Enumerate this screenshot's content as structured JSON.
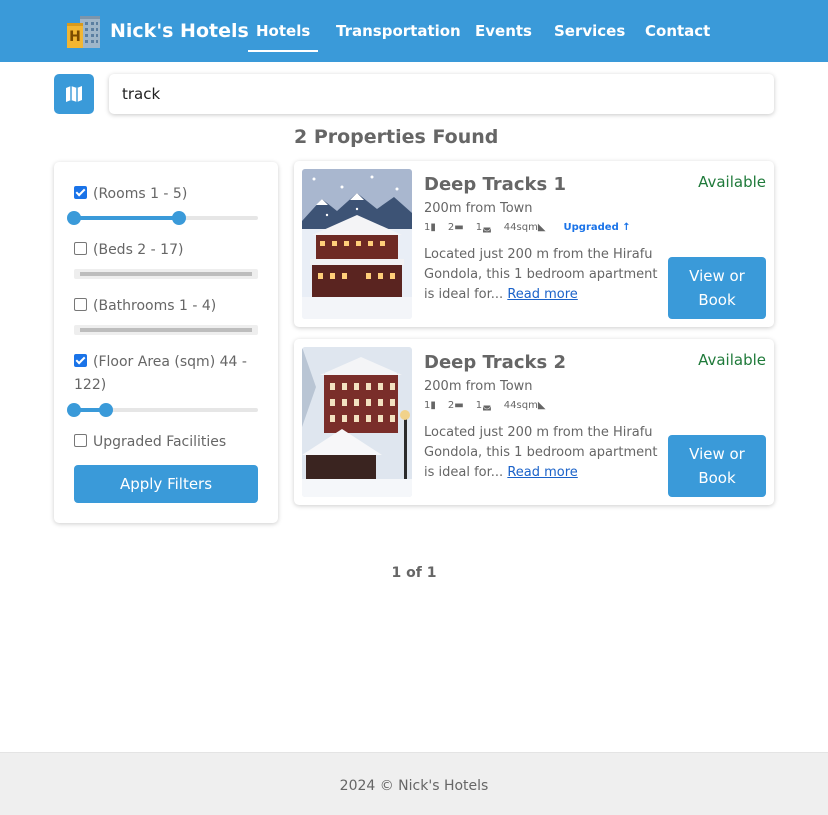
{
  "brand": {
    "name": "Nick's Hotels",
    "icon": "hotel-building-icon"
  },
  "nav": {
    "items": [
      {
        "label": "Hotels",
        "active": true
      },
      {
        "label": "Transportation",
        "active": false
      },
      {
        "label": "Events",
        "active": false
      },
      {
        "label": "Services",
        "active": false
      },
      {
        "label": "Contact",
        "active": false
      }
    ]
  },
  "search": {
    "value": "track",
    "map_icon": "map-icon"
  },
  "results": {
    "title": "2 Properties Found"
  },
  "filters": {
    "rooms": {
      "label": "(Rooms 1 - 5)",
      "checked": true,
      "range": [
        1,
        5
      ]
    },
    "beds": {
      "label": "(Beds 2 - 17)",
      "checked": false,
      "range": [
        2,
        17
      ]
    },
    "bathrooms": {
      "label": "(Bathrooms 1 - 4)",
      "checked": false,
      "range": [
        1,
        4
      ]
    },
    "floor_area": {
      "label": "(Floor Area (sqm) 44 - 122)",
      "checked": true,
      "range": [
        44,
        122
      ]
    },
    "upgraded": {
      "label": "Upgraded Facilities",
      "checked": false
    },
    "apply_label": "Apply Filters"
  },
  "properties": [
    {
      "title": "Deep Tracks 1",
      "distance": "200m from Town",
      "rooms": "1",
      "beds": "2",
      "baths": "1",
      "area": "44sqm",
      "upgraded": "Upgraded ↑",
      "status": "Available",
      "description": "Located just 200 m from the Hirafu Gondola, this 1 bedroom apartment is ideal for...",
      "read_more": "Read more",
      "button": "View or Book"
    },
    {
      "title": "Deep Tracks 2",
      "distance": "200m from Town",
      "rooms": "1",
      "beds": "2",
      "baths": "1",
      "area": "44sqm",
      "upgraded": "",
      "status": "Available",
      "description": "Located just 200 m from the Hirafu Gondola, this 1 bedroom apartment is ideal for...",
      "read_more": "Read more",
      "button": "View or Book"
    }
  ],
  "pagination": {
    "text": "1 of 1"
  },
  "footer": {
    "text": "2024 © Nick's Hotels"
  },
  "colors": {
    "primary": "#3a9ad9",
    "available": "#1f7a3a",
    "link": "#1a62c9"
  }
}
